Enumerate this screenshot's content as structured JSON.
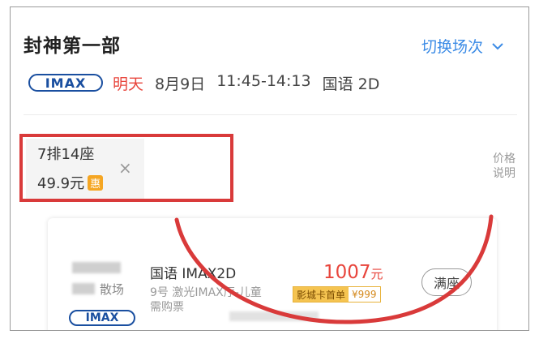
{
  "movie": {
    "title": "封神第一部"
  },
  "header": {
    "switch_label": "切换场次"
  },
  "session": {
    "badge": "IMAX",
    "day": "明天",
    "date": "8月9日",
    "time": "11:45-14:13",
    "lang_format": "国语 2D"
  },
  "seat": {
    "label": "7排14座",
    "price": "49.9元",
    "discount_tag": "惠",
    "remove": "×"
  },
  "price_note": {
    "line1": "价格",
    "line2": "说明"
  },
  "card": {
    "hall_suffix": "散场",
    "badge": "IMAX",
    "format": "国语 IMAX2D",
    "hall_info": "9号 激光IMAX厅-儿童",
    "need_ticket": "需购票",
    "price": "1007",
    "price_unit": "元",
    "promo_label": "影城卡首单",
    "promo_price": "¥999",
    "status_button": "满座"
  },
  "colors": {
    "accent_blue": "#3b8be6",
    "imax_blue": "#1a4fa0",
    "price_red": "#e8453c",
    "annotation_red": "#d93a3a",
    "promo_orange": "#f5a623"
  },
  "icons": {
    "switch": "chevron-down-icon",
    "remove": "close-icon"
  }
}
